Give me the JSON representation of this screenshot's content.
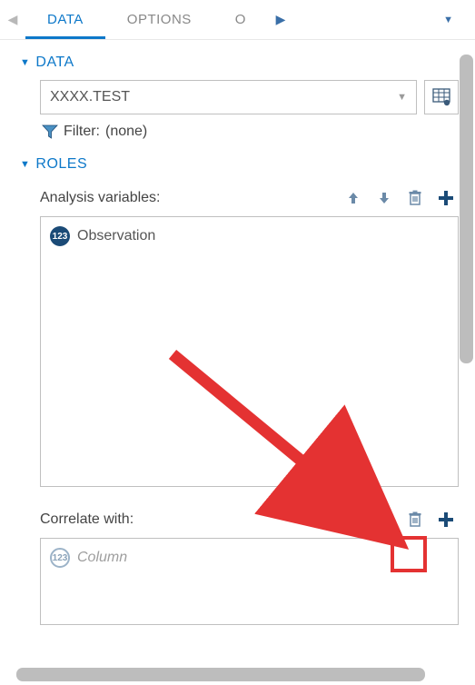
{
  "tabs": {
    "items": [
      "DATA",
      "OPTIONS",
      "O"
    ],
    "active_index": 0
  },
  "sections": {
    "data": {
      "title": "DATA",
      "dataset": "XXXX.TEST",
      "filter_label": "Filter:",
      "filter_value": "(none)"
    },
    "roles": {
      "title": "ROLES",
      "analysis": {
        "label": "Analysis variables:",
        "items": [
          "Observation"
        ]
      },
      "correlate": {
        "label": "Correlate with:",
        "placeholder": "Column"
      }
    }
  },
  "icons": {
    "num_badge": "123"
  }
}
